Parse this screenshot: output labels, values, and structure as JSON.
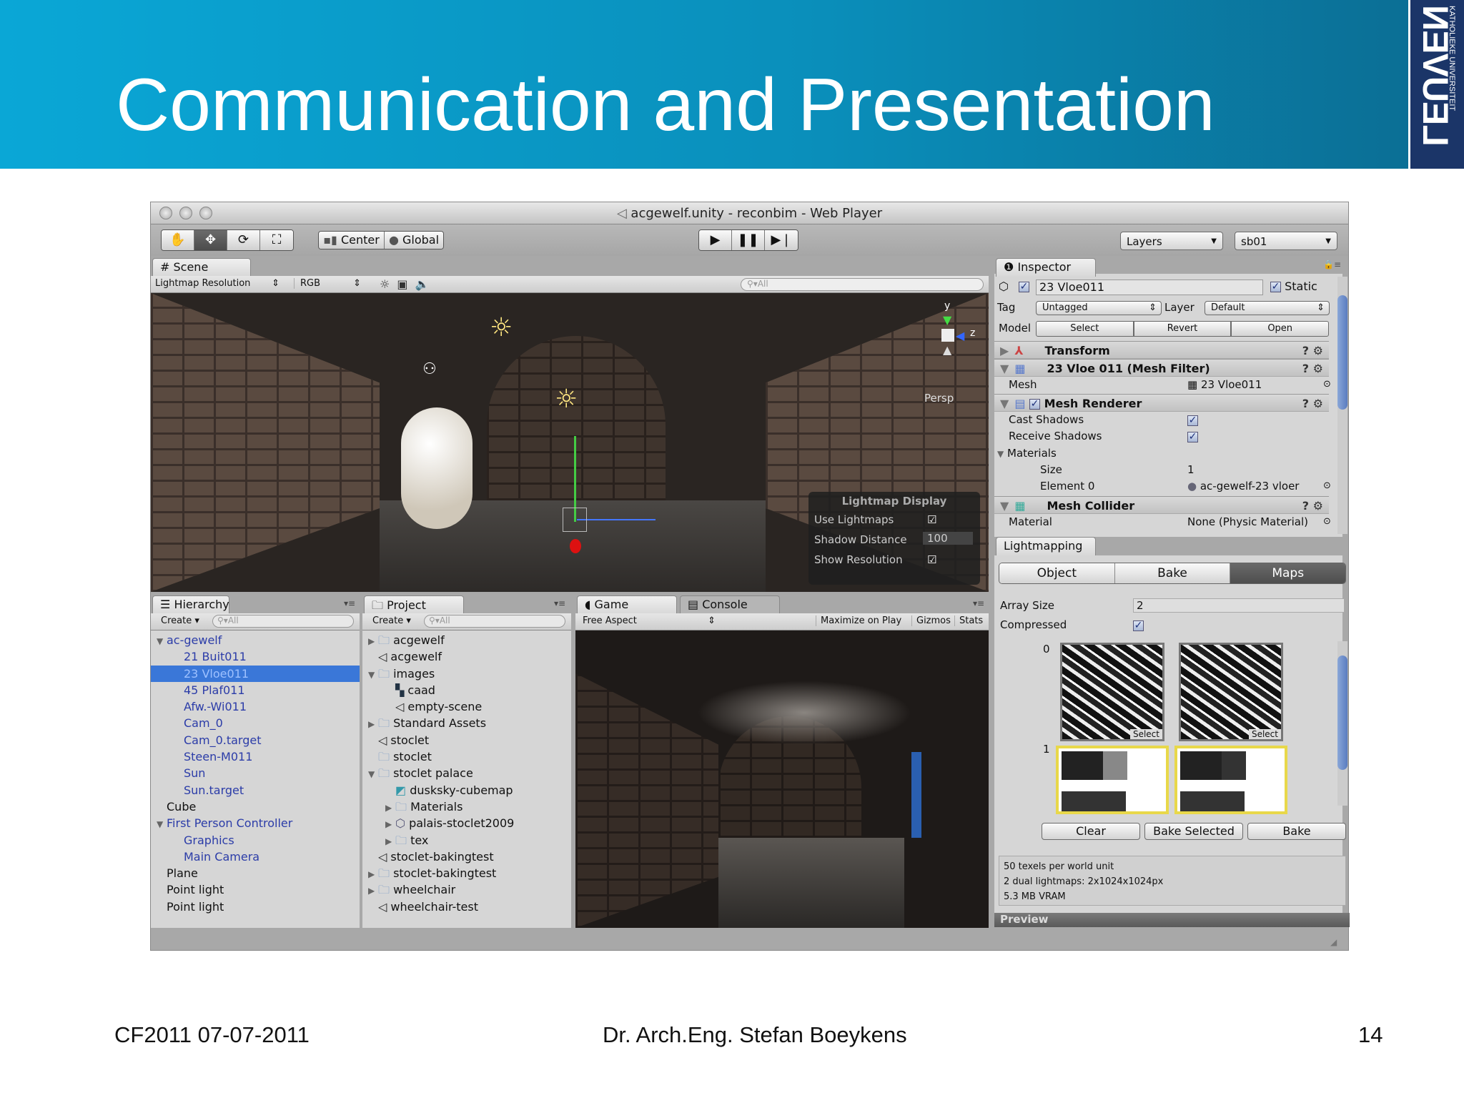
{
  "slide": {
    "title": "Communication and Presentation",
    "logo_text": "LEUVEN",
    "logo_subtext": "KATHOLIEKE UNIVERSITEIT",
    "footer_left": "CF2011 07-07-2011",
    "footer_center": "Dr. Arch.Eng. Stefan Boeykens",
    "page_number": "14"
  },
  "window": {
    "title": "acgewelf.unity - reconbim - Web Player"
  },
  "toolbar": {
    "pivot": "Center",
    "space": "Global",
    "layers": "Layers",
    "layout": "sb01"
  },
  "scene": {
    "tab": "Scene",
    "render_mode": "Lightmap Resolution",
    "channel": "RGB",
    "search_placeholder": "All",
    "gizmo_label": "Persp",
    "axis_y": "y",
    "axis_z": "z",
    "lightmap_display": {
      "title": "Lightmap Display",
      "use_lightmaps": "Use Lightmaps",
      "shadow_distance_label": "Shadow Distance",
      "shadow_distance": "100",
      "show_resolution": "Show Resolution"
    }
  },
  "inspector": {
    "tab": "Inspector",
    "object_name": "23 Vloe011",
    "static": "Static",
    "tag_label": "Tag",
    "tag": "Untagged",
    "layer_label": "Layer",
    "layer": "Default",
    "model_label": "Model",
    "model_buttons": [
      "Select",
      "Revert",
      "Open"
    ],
    "transform": "Transform",
    "mesh_filter": "23 Vloe 011 (Mesh Filter)",
    "mesh_label": "Mesh",
    "mesh_value": "23 Vloe011",
    "mesh_renderer": "Mesh Renderer",
    "cast_shadows": "Cast Shadows",
    "receive_shadows": "Receive Shadows",
    "materials": "Materials",
    "size_label": "Size",
    "size": "1",
    "element0_label": "Element 0",
    "element0": "ac-gewelf-23 vloer",
    "mesh_collider": "Mesh Collider",
    "material_label": "Material",
    "material": "None (Physic Material)"
  },
  "lightmapping": {
    "tab": "Lightmapping",
    "modes": [
      "Object",
      "Bake",
      "Maps"
    ],
    "array_size_label": "Array Size",
    "array_size": "2",
    "compressed_label": "Compressed",
    "index0": "0",
    "index1": "1",
    "select": "Select",
    "buttons": [
      "Clear",
      "Bake Selected",
      "Bake"
    ],
    "info": [
      "50 texels per world unit",
      "2 dual lightmaps: 2x1024x1024px",
      "5.3 MB VRAM"
    ],
    "preview": "Preview"
  },
  "hierarchy": {
    "tab": "Hierarchy",
    "create": "Create",
    "search_placeholder": "All",
    "items": [
      {
        "label": "ac-gewelf",
        "level": 0,
        "expanded": true,
        "blue": true
      },
      {
        "label": "21 Buit011",
        "level": 1,
        "blue": true
      },
      {
        "label": "23 Vloe011",
        "level": 1,
        "blue": true,
        "selected": true
      },
      {
        "label": "45 Plaf011",
        "level": 1,
        "blue": true
      },
      {
        "label": "Afw.-Wi011",
        "level": 1,
        "blue": true
      },
      {
        "label": "Cam_0",
        "level": 1,
        "blue": true
      },
      {
        "label": "Cam_0.target",
        "level": 1,
        "blue": true
      },
      {
        "label": "Steen-M011",
        "level": 1,
        "blue": true
      },
      {
        "label": "Sun",
        "level": 1,
        "blue": true
      },
      {
        "label": "Sun.target",
        "level": 1,
        "blue": true
      },
      {
        "label": "Cube",
        "level": 0
      },
      {
        "label": "First Person Controller",
        "level": 0,
        "expanded": true,
        "blue": true
      },
      {
        "label": "Graphics",
        "level": 1,
        "blue": true
      },
      {
        "label": "Main Camera",
        "level": 1,
        "blue": true
      },
      {
        "label": "Plane",
        "level": 0
      },
      {
        "label": "Point light",
        "level": 0
      },
      {
        "label": "Point light",
        "level": 0
      }
    ]
  },
  "project": {
    "tab": "Project",
    "create": "Create",
    "search_placeholder": "All",
    "items": [
      {
        "label": "acgewelf",
        "level": 0,
        "icon": "folder",
        "arrow": "right"
      },
      {
        "label": "acgewelf",
        "level": 0,
        "icon": "unity"
      },
      {
        "label": "images",
        "level": 0,
        "icon": "folder",
        "arrow": "down"
      },
      {
        "label": "caad",
        "level": 1,
        "icon": "texture"
      },
      {
        "label": "empty-scene",
        "level": 1,
        "icon": "unity"
      },
      {
        "label": "Standard Assets",
        "level": 0,
        "icon": "folder",
        "arrow": "right"
      },
      {
        "label": "stoclet",
        "level": 0,
        "icon": "unity"
      },
      {
        "label": "stoclet",
        "level": 0,
        "icon": "folder"
      },
      {
        "label": "stoclet palace",
        "level": 0,
        "icon": "folder",
        "arrow": "down"
      },
      {
        "label": "dusksky-cubemap",
        "level": 1,
        "icon": "cubemap"
      },
      {
        "label": "Materials",
        "level": 1,
        "icon": "folder",
        "arrow": "right"
      },
      {
        "label": "palais-stoclet2009",
        "level": 1,
        "icon": "model",
        "arrow": "right"
      },
      {
        "label": "tex",
        "level": 1,
        "icon": "folder",
        "arrow": "right"
      },
      {
        "label": "stoclet-bakingtest",
        "level": 0,
        "icon": "unity"
      },
      {
        "label": "stoclet-bakingtest",
        "level": 0,
        "icon": "folder",
        "arrow": "right"
      },
      {
        "label": "wheelchair",
        "level": 0,
        "icon": "folder",
        "arrow": "right"
      },
      {
        "label": "wheelchair-test",
        "level": 0,
        "icon": "unity"
      }
    ]
  },
  "game": {
    "tab": "Game",
    "console_tab": "Console",
    "aspect": "Free Aspect",
    "maximize": "Maximize on Play",
    "gizmos": "Gizmos",
    "stats": "Stats"
  },
  "colors": {
    "header": "#0a9fcf",
    "selection": "#3a77d8",
    "logo": "#1b3568"
  }
}
